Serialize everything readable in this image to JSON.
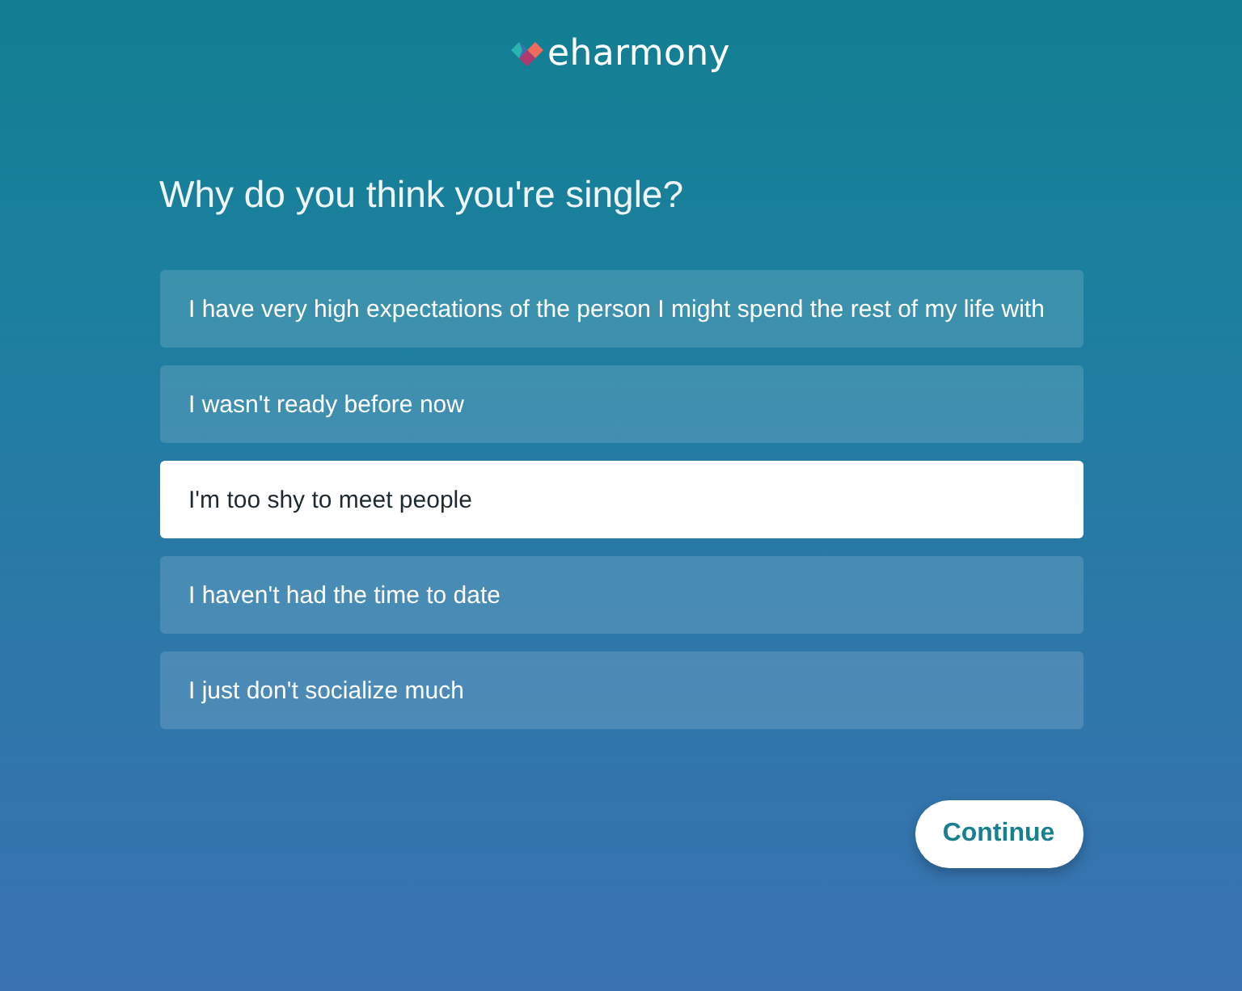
{
  "header": {
    "logo_text": "eharmony"
  },
  "question": "Why do you think you're single?",
  "options": [
    {
      "label": "I have very high expectations of the person I might spend the rest of my life with",
      "selected": false
    },
    {
      "label": "I wasn't ready before now",
      "selected": false
    },
    {
      "label": "I'm too shy to meet people",
      "selected": true
    },
    {
      "label": "I haven't had the time to date",
      "selected": false
    },
    {
      "label": "I just don't socialize much",
      "selected": false
    }
  ],
  "continue_button": {
    "label": "Continue"
  }
}
